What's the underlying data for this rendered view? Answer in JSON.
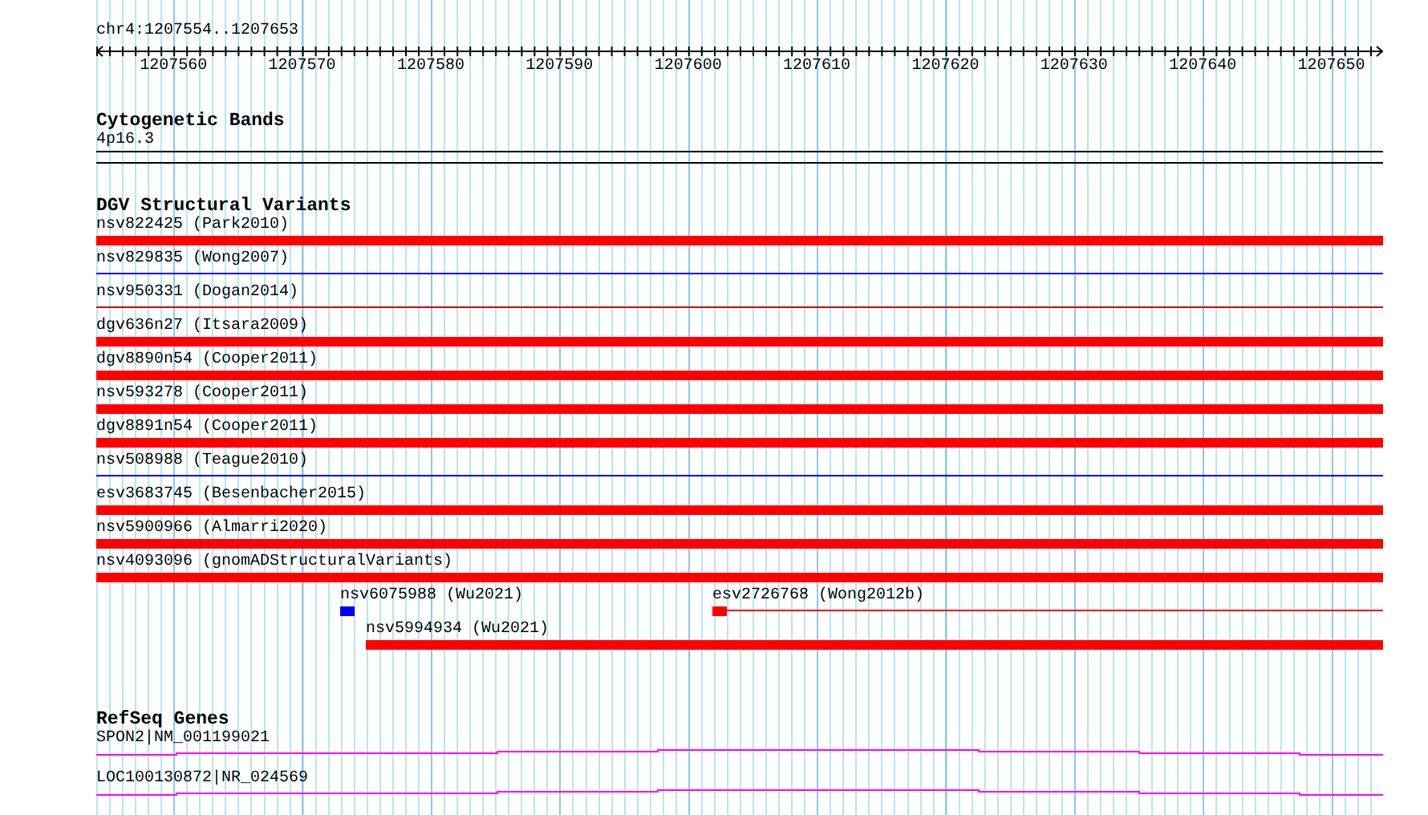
{
  "location": "chr4:1207554..1207653",
  "ruler": {
    "ticks": [
      "1207560",
      "1207570",
      "1207580",
      "1207590",
      "1207600",
      "1207610",
      "1207620",
      "1207630",
      "1207640",
      "1207650"
    ]
  },
  "tracks": [
    {
      "kind": "bands",
      "title": "Cytogenetic Bands",
      "features": [
        {
          "label": "4p16.3"
        }
      ]
    },
    {
      "kind": "variants",
      "title": "DGV Structural Variants",
      "features": [
        {
          "label": "nsv822425 (Park2010)",
          "kind": "thick",
          "color": "#ff0000"
        },
        {
          "label": "nsv829835 (Wong2007)",
          "kind": "thin",
          "color": "#0000ff"
        },
        {
          "label": "nsv950331 (Dogan2014)",
          "kind": "thin",
          "color": "#cc0000"
        },
        {
          "label": "dgv636n27 (Itsara2009)",
          "kind": "thick",
          "color": "#ff0000"
        },
        {
          "label": "dgv8890n54 (Cooper2011)",
          "kind": "thick",
          "color": "#ff0000"
        },
        {
          "label": "nsv593278 (Cooper2011)",
          "kind": "thick",
          "color": "#ff0000"
        },
        {
          "label": "dgv8891n54 (Cooper2011)",
          "kind": "thick",
          "color": "#ff0000"
        },
        {
          "label": "nsv508988 (Teague2010)",
          "kind": "thin",
          "color": "#0000ff"
        },
        {
          "label": "esv3683745 (Besenbacher2015)",
          "kind": "thick",
          "color": "#ff0000"
        },
        {
          "label": "nsv5900966 (Almarri2020)",
          "kind": "thick",
          "color": "#ff0000"
        },
        {
          "label": "nsv4093096 (gnomADStructuralVariants)",
          "kind": "thick",
          "color": "#ff0000"
        }
      ],
      "packed_rows": [
        [
          {
            "label": "nsv6075988 (Wu2021)",
            "kind": "block",
            "color": "#0000ff"
          },
          {
            "label": "esv2726768 (Wong2012b)",
            "kind": "block-line",
            "color": "#ff0000"
          }
        ],
        [
          {
            "label": "nsv5994934 (Wu2021)",
            "kind": "thick",
            "color": "#ff0000"
          }
        ]
      ]
    },
    {
      "kind": "genes",
      "title": "RefSeq Genes",
      "features": [
        {
          "label": "SPON2|NM_001199021"
        },
        {
          "label": "LOC100130872|NR_024569"
        }
      ]
    }
  ]
}
